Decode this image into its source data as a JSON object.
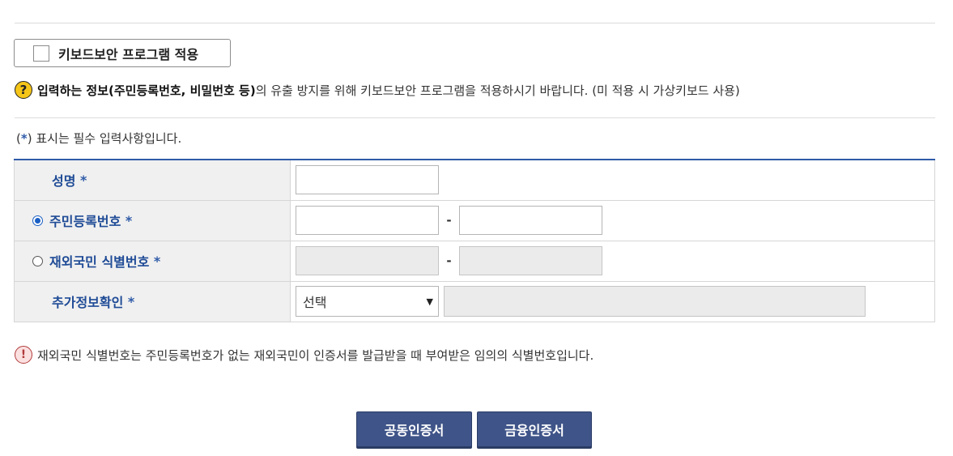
{
  "keyboard_security": {
    "label": "키보드보안 프로그램 적용",
    "checked": false
  },
  "notice": {
    "icon": "?",
    "bold_text": "입력하는 정보(주민등록번호, 비밀번호 등)",
    "text": "의 유출 방지를 위해 키보드보안 프로그램을 적용하시기 바랍니다. (미 적용 시 가상키보드 사용)"
  },
  "required_note": {
    "open": "(",
    "star": "*",
    "text": ") 표시는 필수 입력사항입니다."
  },
  "form": {
    "name_label": "성명",
    "resident_label": "주민등록번호",
    "overseas_label": "재외국민 식별번호",
    "extra_label": "추가정보확인",
    "required_star": "*",
    "dash": "-",
    "select_value": "선택",
    "resident_selected": true
  },
  "info": {
    "icon": "!",
    "text": "재외국민 식별번호는 주민등록번호가 없는 재외국민이 인증서를 발급받을 때 부여받은 임의의 식별번호입니다."
  },
  "buttons": {
    "joint_cert": "공동인증서",
    "financial_cert": "금융인증서"
  },
  "colors": {
    "accent": "#2f5ba8",
    "button": "#3f5488"
  }
}
